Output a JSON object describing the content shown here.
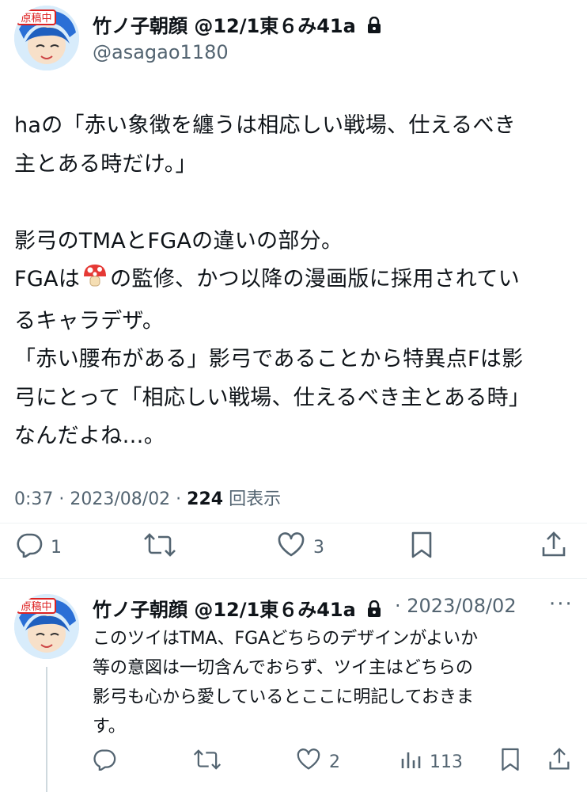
{
  "tweet": {
    "display_name": "竹ノ子朝顔 @12/1東６み41a",
    "handle": "@asagao1180",
    "body_lines": [
      "haの「赤い象徴を纏うは相応しい戦場、仕えるべき",
      "主とある時だけ。」",
      "",
      "影弓のTMAとFGAの違いの部分。",
      "FGAは",
      "の監修、かつ以降の漫画版に採用されてい",
      "るキャラデザ。",
      "「赤い腰布がある」影弓であることから特異点Fは影",
      "弓にとって「相応しい戦場、仕えるべき主とある時」",
      "なんだよね…。"
    ],
    "time": "0:37 · 2023/08/02 · ",
    "views_count": "224",
    "views_label": "回表示",
    "actions": {
      "reply_count": "1",
      "like_count": "3"
    }
  },
  "reply": {
    "display_name": "竹ノ子朝顔 @12/1東６み41a",
    "date": "· 2023/08/02",
    "more": "···",
    "lines": [
      "このツイはTMA、FGAどちらのデザインがよいか",
      "等の意図は一切含んでおらず、ツイ主はどちらの",
      "影弓も心から愛しているとここに明記しておきま",
      "す。"
    ],
    "actions": {
      "like_count": "2",
      "views_count": "113"
    }
  },
  "icons": [
    "lock-icon",
    "reply-icon",
    "retweet-icon",
    "like-icon",
    "bookmark-icon",
    "share-icon",
    "views-icon",
    "mushroom-emoji"
  ],
  "colors": {
    "text": "#0f1419",
    "secondary": "#536471",
    "divider": "#eff3f4"
  }
}
